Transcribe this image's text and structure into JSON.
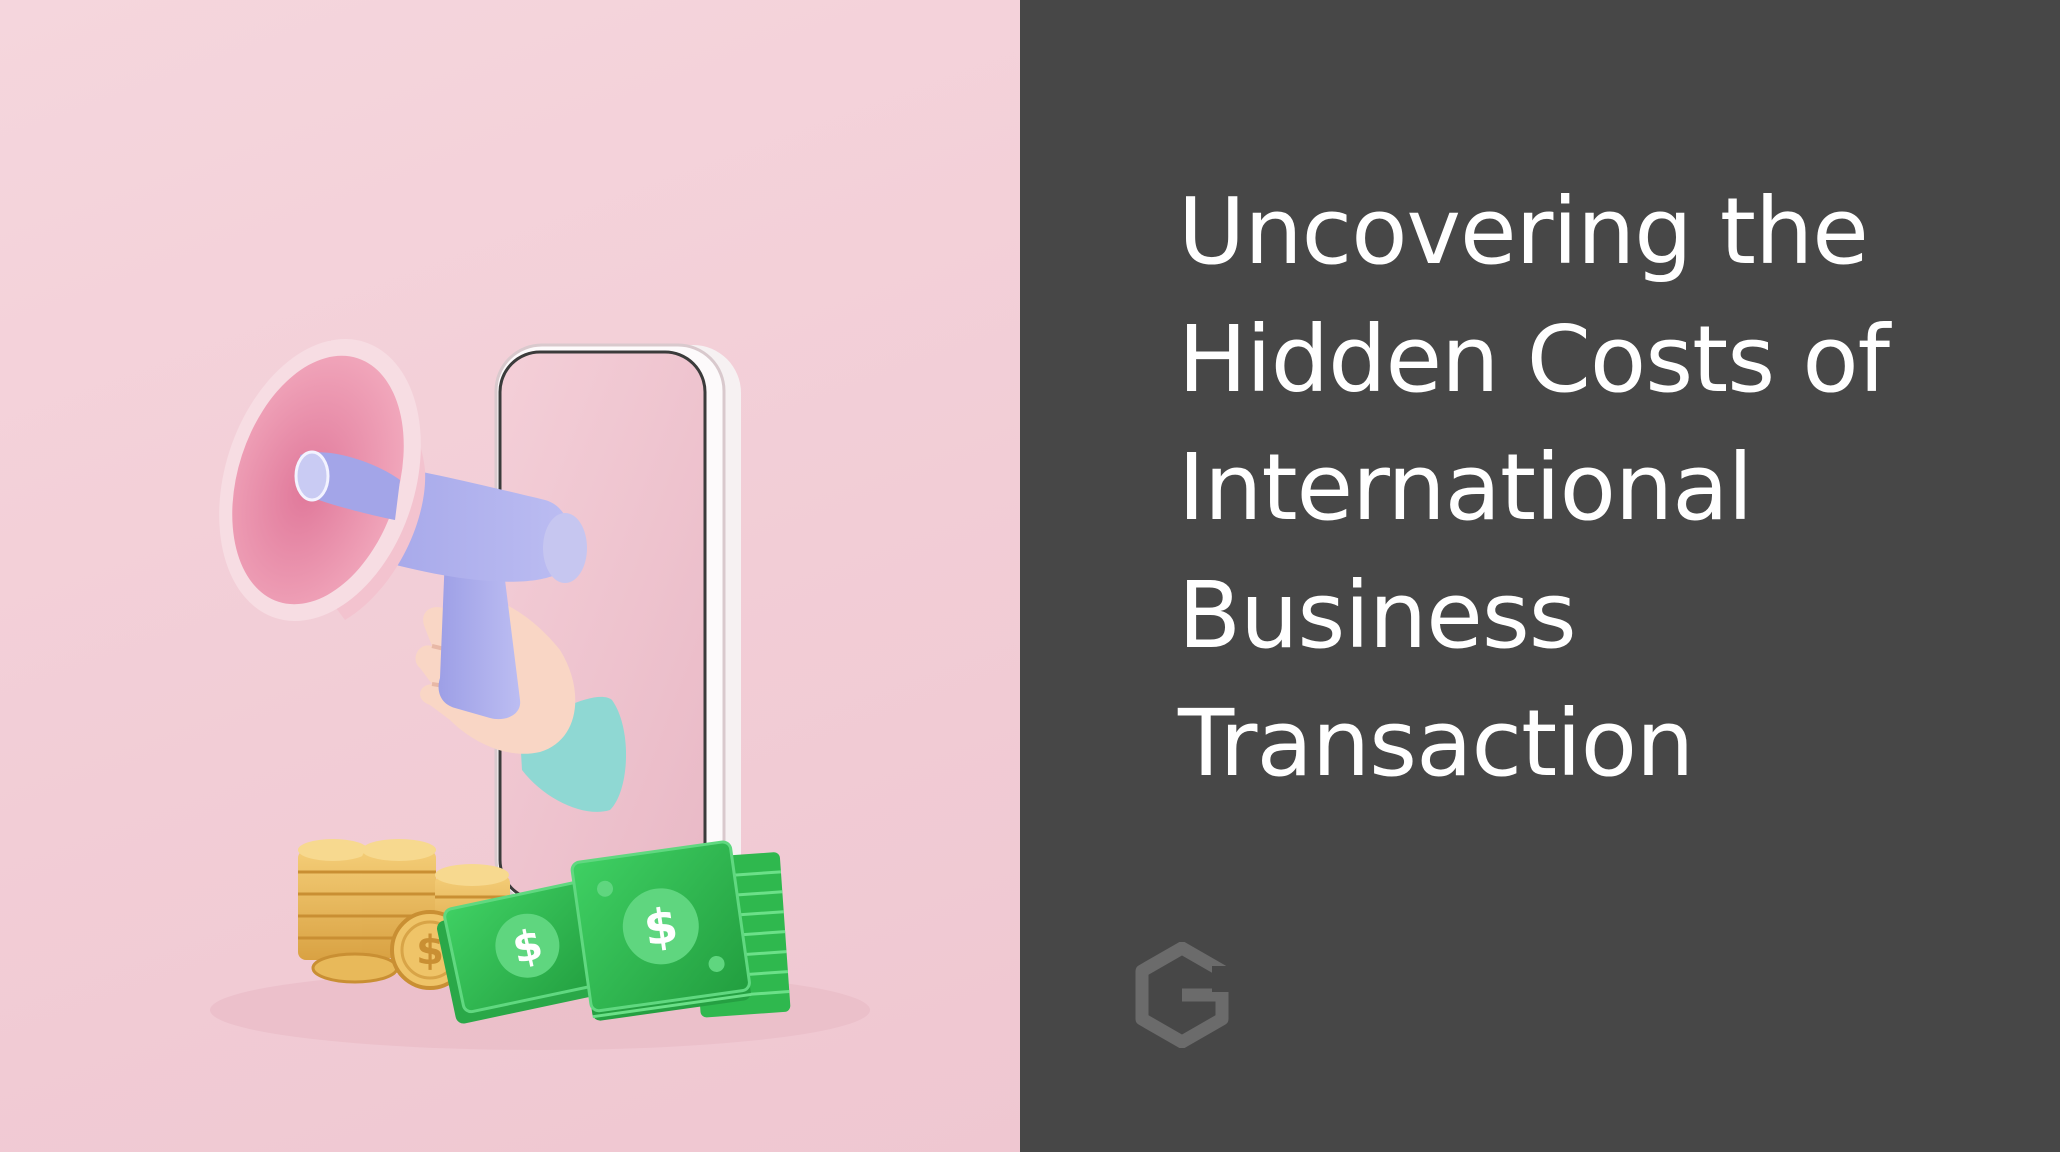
{
  "heading": {
    "lines": [
      "Uncovering the",
      "Hidden Costs of",
      "International",
      "Business",
      "Transaction"
    ]
  },
  "hero_image": {
    "objects": [
      "megaphone-icon",
      "phone-icon",
      "hand-icon",
      "coin-stack-icon",
      "banknote-stack-icon",
      "dollar-sign-icon"
    ]
  },
  "logo": {
    "icon": "hexagon-logo-icon"
  },
  "colors": {
    "hero_background": "#f3d1d9",
    "panel_background": "#474747",
    "heading_text": "#ffffff",
    "logo": "#6b6b6b",
    "cash_green": "#2fb84e",
    "coin_gold": "#e8b95a",
    "megaphone_pink": "#e68aa3",
    "megaphone_handle": "#a8a8e6"
  }
}
